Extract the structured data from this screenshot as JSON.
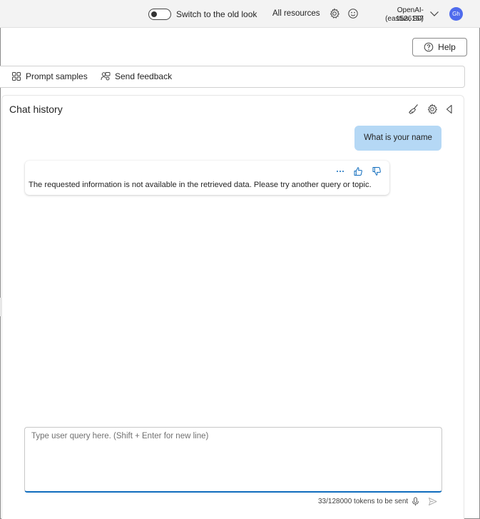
{
  "topbar": {
    "toggle_label": "Switch to the old look",
    "all_resources": "All resources",
    "account_name": "OpenAI-1526157",
    "account_region": "(eastus, S0)",
    "avatar_initials": "Gh",
    "icons": [
      "gear-icon",
      "smiley-icon",
      "chevron-down-icon"
    ]
  },
  "help": {
    "label": "Help",
    "icon": "question-circle-icon"
  },
  "toolbar": {
    "prompt_samples": "Prompt samples",
    "send_feedback": "Send feedback"
  },
  "chat": {
    "title": "Chat history",
    "header_icons": [
      "broom-icon",
      "gear-icon",
      "collapse-icon"
    ],
    "messages": [
      {
        "role": "user",
        "text": "What is your name"
      },
      {
        "role": "assistant",
        "text": "The requested information is not available in the retrieved data. Please try another query or topic."
      }
    ],
    "input": {
      "placeholder": "Type user query here. (Shift + Enter for new line)",
      "value": ""
    },
    "token_count": "33/128000 tokens to be sent"
  },
  "colors": {
    "user_bubble": "#b5d8f5",
    "avatar": "#4f6bed",
    "accent": "#0f6cbd"
  }
}
